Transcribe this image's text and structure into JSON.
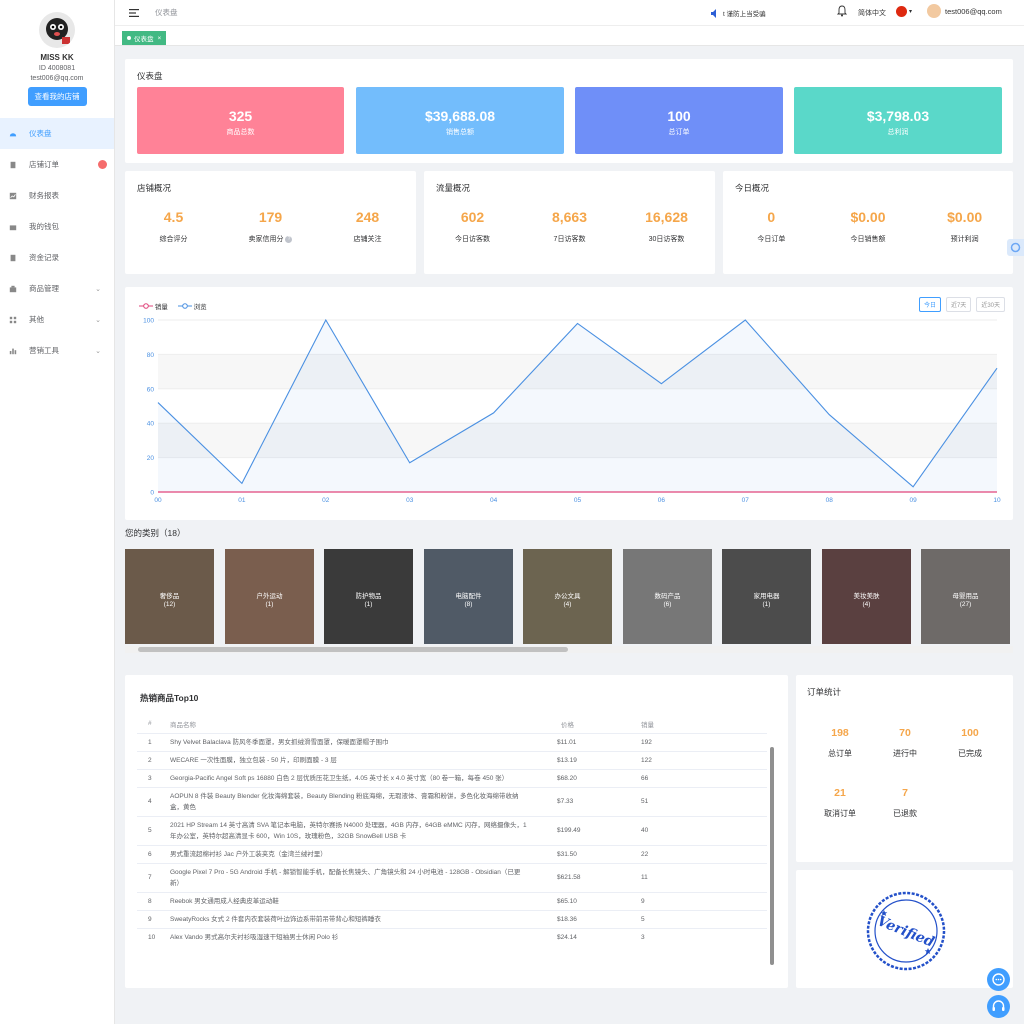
{
  "sidebar": {
    "name": "MISS KK",
    "id": "ID 4008081",
    "email": "test006@qq.com",
    "store_button": "查看我的店铺",
    "items": [
      {
        "label": "仪表盘"
      },
      {
        "label": "店铺订单"
      },
      {
        "label": "财务报表"
      },
      {
        "label": "我的钱包"
      },
      {
        "label": "资金记录"
      },
      {
        "label": "商品管理"
      },
      {
        "label": "其他"
      },
      {
        "label": "营销工具"
      }
    ]
  },
  "topbar": {
    "breadcrumb": "仪表盘",
    "notice": "t 谨防上当受骗",
    "language": "简体中文",
    "user_email": "test006@qq.com"
  },
  "tags": {
    "active": "仪表盘",
    "close": "×"
  },
  "dashboard": {
    "title": "仪表盘",
    "cards": [
      {
        "value": "325",
        "label": "商品总数",
        "color": "#ff8297"
      },
      {
        "value": "$39,688.08",
        "label": "销售总额",
        "color": "#73bdfc"
      },
      {
        "value": "100",
        "label": "总订单",
        "color": "#6f8ff8"
      },
      {
        "value": "$3,798.03",
        "label": "总利润",
        "color": "#5ad8c9"
      }
    ]
  },
  "store": {
    "title": "店铺概况",
    "items": [
      {
        "value": "4.5",
        "label": "综合评分"
      },
      {
        "value": "179",
        "label": "卖家信用分"
      },
      {
        "value": "248",
        "label": "店铺关注"
      }
    ]
  },
  "traffic": {
    "title": "流量概况",
    "items": [
      {
        "value": "602",
        "label": "今日访客数"
      },
      {
        "value": "8,663",
        "label": "7日访客数"
      },
      {
        "value": "16,628",
        "label": "30日访客数"
      }
    ]
  },
  "today": {
    "title": "今日概况",
    "items": [
      {
        "value": "0",
        "label": "今日订单"
      },
      {
        "value": "$0.00",
        "label": "今日销售额"
      },
      {
        "value": "$0.00",
        "label": "预计利润"
      }
    ]
  },
  "chart_data": {
    "type": "line",
    "x": [
      "00",
      "01",
      "02",
      "03",
      "04",
      "05",
      "06",
      "07",
      "08",
      "09",
      "10"
    ],
    "ylim": [
      0,
      100
    ],
    "yticks": [
      0,
      20,
      40,
      60,
      80,
      100
    ],
    "series": [
      {
        "name": "销量",
        "color": "#e0457b",
        "values": [
          0,
          0,
          0,
          0,
          0,
          0,
          0,
          0,
          0,
          0,
          0
        ]
      },
      {
        "name": "浏览",
        "color": "#4a90e2",
        "values": [
          52,
          5,
          100,
          17,
          46,
          98,
          63,
          100,
          45,
          3,
          72
        ]
      }
    ],
    "legend": "top-left",
    "range_buttons": [
      "今日",
      "近7天",
      "近30天"
    ]
  },
  "categories": {
    "title": "您的类别（18）",
    "items": [
      {
        "name": "奢侈品",
        "count": "(12)"
      },
      {
        "name": "户外运动",
        "count": "(1)"
      },
      {
        "name": "防护物品",
        "count": "(1)"
      },
      {
        "name": "电脑配件",
        "count": "(8)"
      },
      {
        "name": "办公文具",
        "count": "(4)"
      },
      {
        "name": "数码产品",
        "count": "(6)"
      },
      {
        "name": "家用电器",
        "count": "(1)"
      },
      {
        "name": "美妆美肤",
        "count": "(4)"
      },
      {
        "name": "母婴用品",
        "count": "(27)"
      }
    ]
  },
  "top10": {
    "title": "热销商品Top10",
    "headers": [
      "#",
      "商品名称",
      "价格",
      "销量"
    ],
    "rows": [
      {
        "n": "1",
        "name": "Shy Velvet Balaclava 防风冬季面罩，男女抓绒滑雪面罩，保暖面罩帽子围巾",
        "price": "$11.01",
        "sales": "192"
      },
      {
        "n": "2",
        "name": "WECARE 一次性面膜，独立包装 - 50 片，印刷面膜 - 3 层",
        "price": "$13.19",
        "sales": "122"
      },
      {
        "n": "3",
        "name": "Georgia-Pacific Angel Soft ps 16880 白色 2 层优质压花卫生纸，4.05 英寸长 x 4.0 英寸宽（80 卷一箱，每卷 450 张）",
        "price": "$68.20",
        "sales": "66"
      },
      {
        "n": "4",
        "name": "AOPUN 8 件装 Beauty Blender 化妆海绵套装，Beauty Blending 粉底海绵，无瑕液体、膏霜和粉饼，多色化妆海绵带收纳盒，黄色",
        "price": "$7.33",
        "sales": "51"
      },
      {
        "n": "5",
        "name": "2021 HP Stream 14 英寸高清 SVA 笔记本电脑，英特尔赛扬 N4000 处理器，4GB 内存，64GB eMMC 闪存，网络摄像头，1 年办公室，英特尔超高清显卡 600，Win 10S，玫瑰粉色，32GB SnowBell USB 卡",
        "price": "$199.49",
        "sales": "40"
      },
      {
        "n": "6",
        "name": "男式重流超棉衬衫 Jac 户外工装夹克（金湾兰绒衬里）",
        "price": "$31.50",
        "sales": "22"
      },
      {
        "n": "7",
        "name": "Google Pixel 7 Pro - 5G Android 手机 - 解锁智能手机，配备长焦镜头、广角镜头和 24 小时电池 - 128GB - Obsidian（已更新）",
        "price": "$621.58",
        "sales": "11"
      },
      {
        "n": "8",
        "name": "Reebok 男女通用成人经典皮革运动鞋",
        "price": "$65.10",
        "sales": "9"
      },
      {
        "n": "9",
        "name": "SweatyRocks 女式 2 件套内衣套装荷叶边饰边系带前吊带背心和短裤睡衣",
        "price": "$18.36",
        "sales": "5"
      },
      {
        "n": "10",
        "name": "Alex Vando 男式高尔夫衬衫吸湿速干短袖男士休闲 Polo 衫",
        "price": "$24.14",
        "sales": "3"
      }
    ]
  },
  "orders": {
    "title": "订单统计",
    "items": [
      {
        "value": "198",
        "label": "总订单"
      },
      {
        "value": "70",
        "label": "进行中"
      },
      {
        "value": "100",
        "label": "已完成"
      },
      {
        "value": "21",
        "label": "取消订单"
      },
      {
        "value": "7",
        "label": "已退款"
      }
    ]
  },
  "stamp": {
    "text": "Verified"
  }
}
